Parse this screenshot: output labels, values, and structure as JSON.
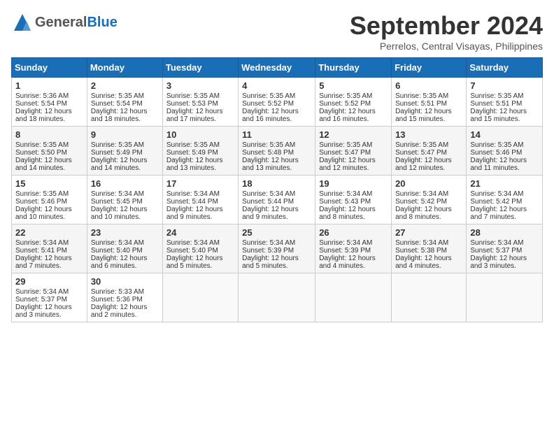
{
  "header": {
    "logo_general": "General",
    "logo_blue": "Blue",
    "month_title": "September 2024",
    "location": "Perrelos, Central Visayas, Philippines"
  },
  "weekdays": [
    "Sunday",
    "Monday",
    "Tuesday",
    "Wednesday",
    "Thursday",
    "Friday",
    "Saturday"
  ],
  "weeks": [
    [
      {
        "day": "1",
        "sunrise": "Sunrise: 5:36 AM",
        "sunset": "Sunset: 5:54 PM",
        "daylight": "Daylight: 12 hours and 18 minutes."
      },
      {
        "day": "2",
        "sunrise": "Sunrise: 5:35 AM",
        "sunset": "Sunset: 5:54 PM",
        "daylight": "Daylight: 12 hours and 18 minutes."
      },
      {
        "day": "3",
        "sunrise": "Sunrise: 5:35 AM",
        "sunset": "Sunset: 5:53 PM",
        "daylight": "Daylight: 12 hours and 17 minutes."
      },
      {
        "day": "4",
        "sunrise": "Sunrise: 5:35 AM",
        "sunset": "Sunset: 5:52 PM",
        "daylight": "Daylight: 12 hours and 16 minutes."
      },
      {
        "day": "5",
        "sunrise": "Sunrise: 5:35 AM",
        "sunset": "Sunset: 5:52 PM",
        "daylight": "Daylight: 12 hours and 16 minutes."
      },
      {
        "day": "6",
        "sunrise": "Sunrise: 5:35 AM",
        "sunset": "Sunset: 5:51 PM",
        "daylight": "Daylight: 12 hours and 15 minutes."
      },
      {
        "day": "7",
        "sunrise": "Sunrise: 5:35 AM",
        "sunset": "Sunset: 5:51 PM",
        "daylight": "Daylight: 12 hours and 15 minutes."
      }
    ],
    [
      {
        "day": "8",
        "sunrise": "Sunrise: 5:35 AM",
        "sunset": "Sunset: 5:50 PM",
        "daylight": "Daylight: 12 hours and 14 minutes."
      },
      {
        "day": "9",
        "sunrise": "Sunrise: 5:35 AM",
        "sunset": "Sunset: 5:49 PM",
        "daylight": "Daylight: 12 hours and 14 minutes."
      },
      {
        "day": "10",
        "sunrise": "Sunrise: 5:35 AM",
        "sunset": "Sunset: 5:49 PM",
        "daylight": "Daylight: 12 hours and 13 minutes."
      },
      {
        "day": "11",
        "sunrise": "Sunrise: 5:35 AM",
        "sunset": "Sunset: 5:48 PM",
        "daylight": "Daylight: 12 hours and 13 minutes."
      },
      {
        "day": "12",
        "sunrise": "Sunrise: 5:35 AM",
        "sunset": "Sunset: 5:47 PM",
        "daylight": "Daylight: 12 hours and 12 minutes."
      },
      {
        "day": "13",
        "sunrise": "Sunrise: 5:35 AM",
        "sunset": "Sunset: 5:47 PM",
        "daylight": "Daylight: 12 hours and 12 minutes."
      },
      {
        "day": "14",
        "sunrise": "Sunrise: 5:35 AM",
        "sunset": "Sunset: 5:46 PM",
        "daylight": "Daylight: 12 hours and 11 minutes."
      }
    ],
    [
      {
        "day": "15",
        "sunrise": "Sunrise: 5:35 AM",
        "sunset": "Sunset: 5:46 PM",
        "daylight": "Daylight: 12 hours and 10 minutes."
      },
      {
        "day": "16",
        "sunrise": "Sunrise: 5:34 AM",
        "sunset": "Sunset: 5:45 PM",
        "daylight": "Daylight: 12 hours and 10 minutes."
      },
      {
        "day": "17",
        "sunrise": "Sunrise: 5:34 AM",
        "sunset": "Sunset: 5:44 PM",
        "daylight": "Daylight: 12 hours and 9 minutes."
      },
      {
        "day": "18",
        "sunrise": "Sunrise: 5:34 AM",
        "sunset": "Sunset: 5:44 PM",
        "daylight": "Daylight: 12 hours and 9 minutes."
      },
      {
        "day": "19",
        "sunrise": "Sunrise: 5:34 AM",
        "sunset": "Sunset: 5:43 PM",
        "daylight": "Daylight: 12 hours and 8 minutes."
      },
      {
        "day": "20",
        "sunrise": "Sunrise: 5:34 AM",
        "sunset": "Sunset: 5:42 PM",
        "daylight": "Daylight: 12 hours and 8 minutes."
      },
      {
        "day": "21",
        "sunrise": "Sunrise: 5:34 AM",
        "sunset": "Sunset: 5:42 PM",
        "daylight": "Daylight: 12 hours and 7 minutes."
      }
    ],
    [
      {
        "day": "22",
        "sunrise": "Sunrise: 5:34 AM",
        "sunset": "Sunset: 5:41 PM",
        "daylight": "Daylight: 12 hours and 7 minutes."
      },
      {
        "day": "23",
        "sunrise": "Sunrise: 5:34 AM",
        "sunset": "Sunset: 5:40 PM",
        "daylight": "Daylight: 12 hours and 6 minutes."
      },
      {
        "day": "24",
        "sunrise": "Sunrise: 5:34 AM",
        "sunset": "Sunset: 5:40 PM",
        "daylight": "Daylight: 12 hours and 5 minutes."
      },
      {
        "day": "25",
        "sunrise": "Sunrise: 5:34 AM",
        "sunset": "Sunset: 5:39 PM",
        "daylight": "Daylight: 12 hours and 5 minutes."
      },
      {
        "day": "26",
        "sunrise": "Sunrise: 5:34 AM",
        "sunset": "Sunset: 5:39 PM",
        "daylight": "Daylight: 12 hours and 4 minutes."
      },
      {
        "day": "27",
        "sunrise": "Sunrise: 5:34 AM",
        "sunset": "Sunset: 5:38 PM",
        "daylight": "Daylight: 12 hours and 4 minutes."
      },
      {
        "day": "28",
        "sunrise": "Sunrise: 5:34 AM",
        "sunset": "Sunset: 5:37 PM",
        "daylight": "Daylight: 12 hours and 3 minutes."
      }
    ],
    [
      {
        "day": "29",
        "sunrise": "Sunrise: 5:34 AM",
        "sunset": "Sunset: 5:37 PM",
        "daylight": "Daylight: 12 hours and 3 minutes."
      },
      {
        "day": "30",
        "sunrise": "Sunrise: 5:33 AM",
        "sunset": "Sunset: 5:36 PM",
        "daylight": "Daylight: 12 hours and 2 minutes."
      },
      null,
      null,
      null,
      null,
      null
    ]
  ]
}
